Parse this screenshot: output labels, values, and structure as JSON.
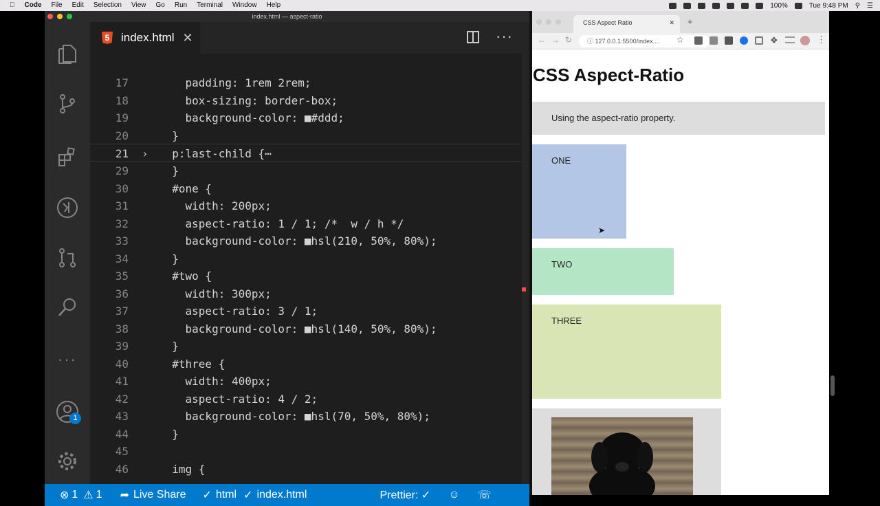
{
  "menubar": {
    "app": "Code",
    "items": [
      "File",
      "Edit",
      "Selection",
      "View",
      "Go",
      "Run",
      "Terminal",
      "Window",
      "Help"
    ],
    "battery": "100%",
    "clock": "Tue 9:48 PM"
  },
  "vscode": {
    "window_title": "index.html — aspect-ratio",
    "tab_label": "index.html",
    "status": {
      "errors": "1",
      "warnings": "1",
      "live_share": "Live Share",
      "language": "html",
      "file": "index.html",
      "prettier": "Prettier: ✓",
      "accounts_badge": "1"
    },
    "lines": [
      {
        "num": "17",
        "code": "    padding: 1rem 2rem;"
      },
      {
        "num": "18",
        "code": "    box-sizing: border-box;"
      },
      {
        "num": "19",
        "code": "    background-color: ■#ddd;"
      },
      {
        "num": "20",
        "code": "  }"
      },
      {
        "num": "21",
        "code": "  p:last-child {⋯"
      },
      {
        "num": "29",
        "code": "  }"
      },
      {
        "num": "30",
        "code": "  #one {"
      },
      {
        "num": "31",
        "code": "    width: 200px;"
      },
      {
        "num": "32",
        "code": "    aspect-ratio: 1 / 1; /*  w / h */"
      },
      {
        "num": "33",
        "code": "    background-color: ■hsl(210, 50%, 80%);"
      },
      {
        "num": "34",
        "code": "  }"
      },
      {
        "num": "35",
        "code": "  #two {"
      },
      {
        "num": "36",
        "code": "    width: 300px;"
      },
      {
        "num": "37",
        "code": "    aspect-ratio: 3 / 1;"
      },
      {
        "num": "38",
        "code": "    background-color: ■hsl(140, 50%, 80%);"
      },
      {
        "num": "39",
        "code": "  }"
      },
      {
        "num": "40",
        "code": "  #three {"
      },
      {
        "num": "41",
        "code": "    width: 400px;"
      },
      {
        "num": "42",
        "code": "    aspect-ratio: 4 / 2;"
      },
      {
        "num": "43",
        "code": "    background-color: ■hsl(70, 50%, 80%);"
      },
      {
        "num": "44",
        "code": "  }"
      },
      {
        "num": "45",
        "code": ""
      },
      {
        "num": "46",
        "code": "  img {"
      }
    ]
  },
  "browser": {
    "tab_title": "CSS Aspect Ratio",
    "url": "127.0.0.1:5500/index....",
    "page_heading": "CSS Aspect-Ratio",
    "intro": "Using the aspect-ratio property.",
    "boxes": [
      {
        "label": "ONE",
        "color": "#b3c6e6"
      },
      {
        "label": "TWO",
        "color": "#b3e6c5"
      },
      {
        "label": "THREE",
        "color": "#d9e6b3"
      }
    ]
  }
}
